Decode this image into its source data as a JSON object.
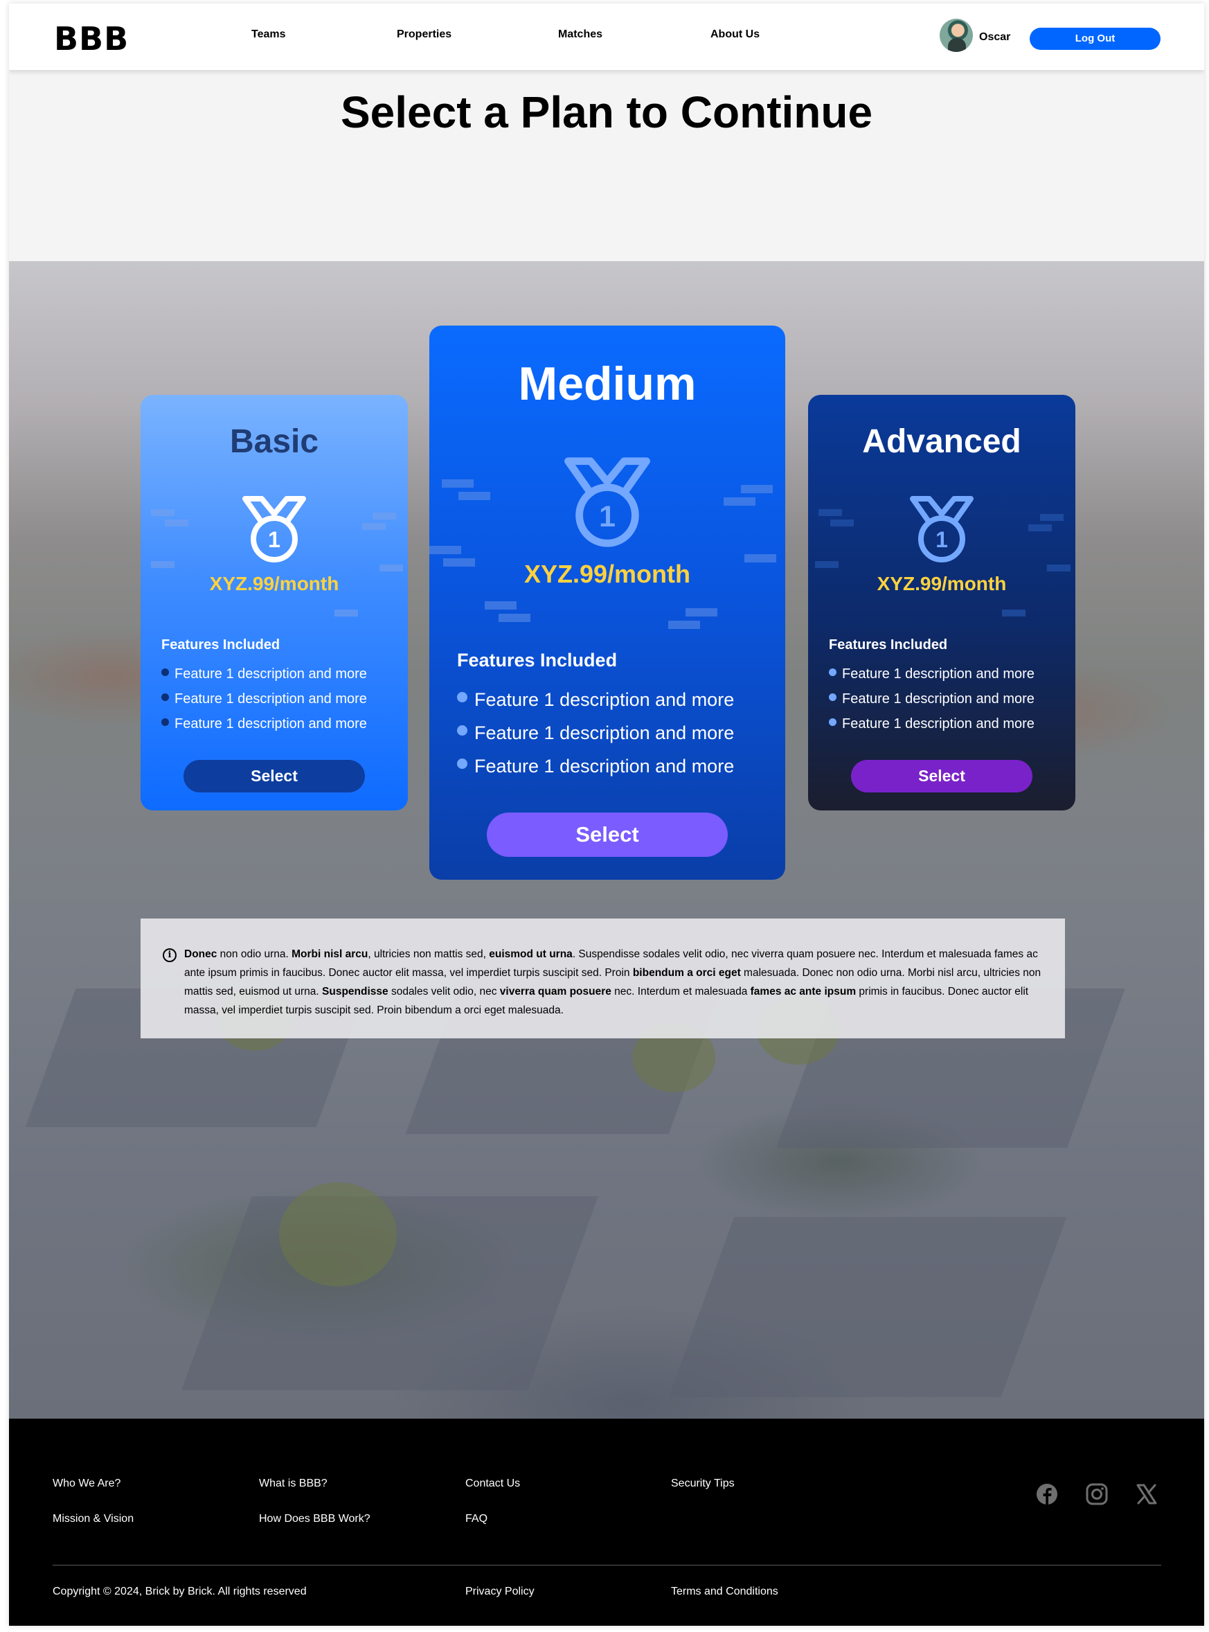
{
  "header": {
    "logo": "BBB",
    "nav": [
      "Teams",
      "Properties",
      "Matches",
      "About Us"
    ],
    "user_name": "Oscar",
    "logout_label": "Log Out"
  },
  "page_title": "Select a Plan to Continue",
  "plans": [
    {
      "name": "Basic",
      "price": "XYZ.99/month",
      "features_title": "Features Included",
      "features": [
        "Feature 1 description and more",
        "Feature 1 description and more",
        "Feature 1 description and more"
      ],
      "select_label": "Select"
    },
    {
      "name": "Medium",
      "price": "XYZ.99/month",
      "features_title": "Features Included",
      "features": [
        "Feature 1 description and more",
        "Feature 1 description and more",
        "Feature 1 description and more"
      ],
      "select_label": "Select"
    },
    {
      "name": "Advanced",
      "price": "XYZ.99/month",
      "features_title": "Features Included",
      "features": [
        "Feature 1 description and more",
        "Feature 1 description and more",
        "Feature 1 description and more"
      ],
      "select_label": "Select"
    }
  ],
  "medal_number": "1",
  "disclaimer": {
    "segments": [
      {
        "text": "Donec",
        "bold": true
      },
      {
        "text": " non odio urna. ",
        "bold": false
      },
      {
        "text": "Morbi nisl arcu",
        "bold": true
      },
      {
        "text": ", ultricies non mattis sed, ",
        "bold": false
      },
      {
        "text": "euismod ut urna",
        "bold": true
      },
      {
        "text": ". Suspendisse sodales velit odio, nec viverra quam posuere nec. Interdum et malesuada fames ac ante ipsum primis in faucibus. Donec auctor elit massa, vel imperdiet turpis suscipit sed. Proin ",
        "bold": false
      },
      {
        "text": "bibendum a orci eget",
        "bold": true
      },
      {
        "text": " malesuada. Donec non odio urna. Morbi nisl arcu, ultricies non mattis sed, euismod ut urna. ",
        "bold": false
      },
      {
        "text": "Suspendisse",
        "bold": true
      },
      {
        "text": " sodales velit odio, nec ",
        "bold": false
      },
      {
        "text": "viverra quam posuere",
        "bold": true
      },
      {
        "text": " nec. Interdum et malesuada ",
        "bold": false
      },
      {
        "text": "fames ac ante ipsum",
        "bold": true
      },
      {
        "text": " primis in faucibus. Donec auctor elit massa, vel imperdiet turpis suscipit sed. Proin bibendum a orci eget malesuada.",
        "bold": false
      }
    ]
  },
  "footer": {
    "links": [
      "Who We Are?",
      "What is BBB?",
      "Contact Us",
      "Security Tips",
      "Mission & Vision",
      "How Does BBB Work?",
      "FAQ"
    ],
    "copyright": "Copyright © 2024, Brick by Brick. All rights reserved",
    "privacy": "Privacy Policy",
    "terms": "Terms and Conditions",
    "social_icons": [
      "facebook-icon",
      "instagram-icon",
      "x-icon"
    ]
  },
  "colors": {
    "accent": "#0066ff",
    "price": "#ffd23f",
    "medium_select": "#7a5cff",
    "advanced_select": "#7a22c9",
    "basic_select": "#0d3d9f"
  }
}
